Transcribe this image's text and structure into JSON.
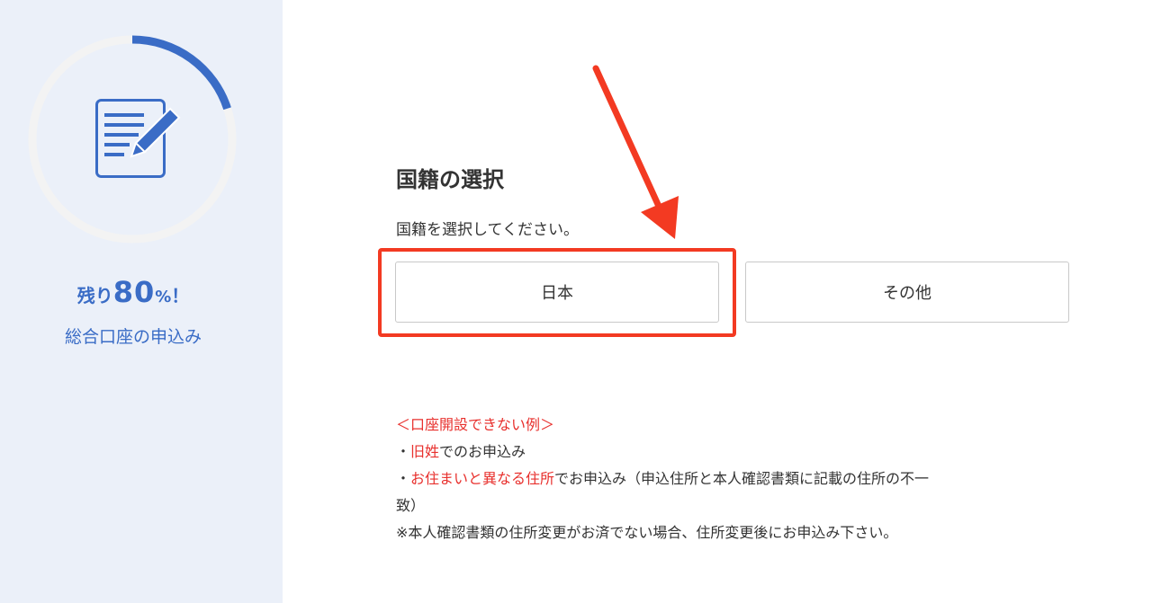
{
  "sidebar": {
    "progress": {
      "remaining_prefix": "残り",
      "remaining_value": "80",
      "remaining_unit": "%",
      "remaining_suffix": "！",
      "fraction_complete": 0.2
    },
    "icon": "document-edit-icon",
    "caption": "総合口座の申込み"
  },
  "section": {
    "title": "国籍の選択",
    "description": "国籍を選択してください。"
  },
  "choices": {
    "japan": "日本",
    "other": "その他"
  },
  "notes": {
    "heading": "＜口座開設できない例＞",
    "bullet1_prefix": "・",
    "bullet1_red": "旧姓",
    "bullet1_rest": "でのお申込み",
    "bullet2_prefix": "・",
    "bullet2_red": "お住まいと異なる住所",
    "bullet2_rest": "でお申込み（申込住所と本人確認書類に記載の住所の不一",
    "bullet2_cont": "致）",
    "footnote": "※本人確認書類の住所変更がお済でない場合、住所変更後にお申込み下さい。"
  },
  "colors": {
    "accent": "#3a6cc6",
    "sidebar_bg": "#ebf0f9",
    "ring_track": "#f3f3f3",
    "highlight": "#f33a22",
    "warning_text": "#e8302d"
  }
}
